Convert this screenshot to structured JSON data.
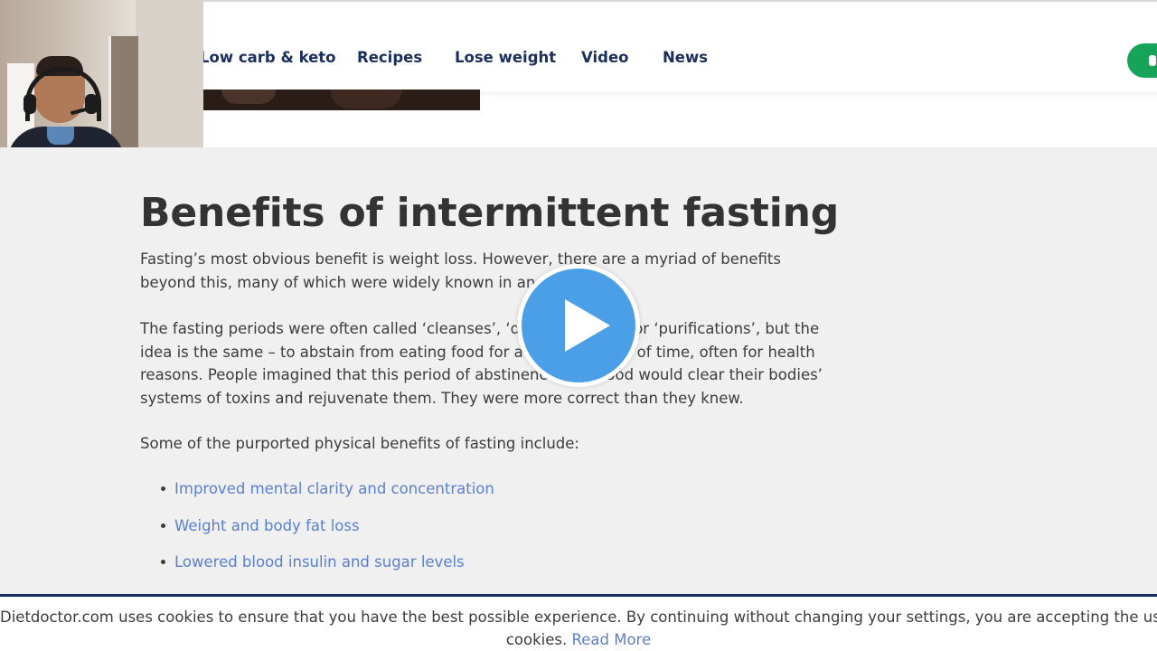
{
  "nav": {
    "items": [
      {
        "label": "Low carb & keto"
      },
      {
        "label": "Recipes"
      },
      {
        "label": "Lose weight"
      },
      {
        "label": "Video"
      },
      {
        "label": "News"
      }
    ]
  },
  "article": {
    "title": "Benefits of intermittent fasting",
    "paragraphs": [
      "Fasting’s most obvious benefit is weight loss. However, there are a myriad of benefits beyond this, many of which were widely known in ancient times.",
      "The fasting periods were often called ‘cleanses’, ‘detoxifications’, or ‘purifications’, but the idea is the same – to abstain from eating food for a certain period of time, often for health reasons. People imagined that this period of abstinence from food would clear their bodies’ systems of toxins and rejuvenate them. They were more correct than they knew.",
      "Some of the purported physical benefits of fasting include:"
    ],
    "benefits": [
      "Improved mental clarity and concentration",
      "Weight and body fat loss",
      "Lowered blood insulin and sugar levels"
    ]
  },
  "cookie": {
    "text": "Dietdoctor.com uses cookies to ensure that you have the best possible experience. By continuing without changing your settings, you are accepting the use of",
    "text2": "cookies.",
    "link": "Read More"
  },
  "colors": {
    "nav_text": "#1a2f5c",
    "link": "#5b7fcf",
    "play_button": "#4a9fe6",
    "cta_green": "#18a35a",
    "content_bg": "#f0f0f0"
  }
}
